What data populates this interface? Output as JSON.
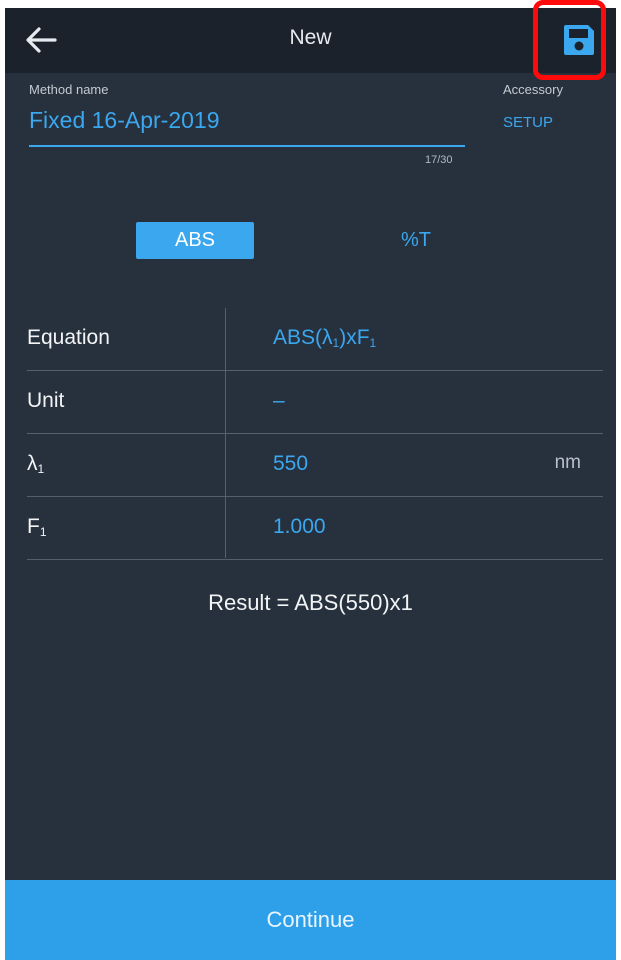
{
  "header": {
    "title": "New",
    "back_icon": "arrow-left-icon",
    "save_icon": "floppy-disk-icon"
  },
  "method": {
    "label": "Method name",
    "value": "Fixed 16-Apr-2019",
    "char_count": "17/30"
  },
  "accessory": {
    "label": "Accessory",
    "setup": "SETUP"
  },
  "mode_toggle": {
    "options": [
      "ABS",
      "%T"
    ],
    "selected": "ABS"
  },
  "params": {
    "equation_key": "Equation",
    "equation_value_a": "ABS(λ",
    "equation_sub_a": "1",
    "equation_value_b": ")xF",
    "equation_sub_b": "1",
    "unit_key": "Unit",
    "unit_value": "–",
    "lambda_key": "λ",
    "lambda_sub": "1",
    "lambda_value": "550",
    "lambda_unit": "nm",
    "f_key": "F",
    "f_sub": "1",
    "f_value": "1.000"
  },
  "result": "Result = ABS(550)x1",
  "footer": {
    "continue": "Continue"
  },
  "colors": {
    "accent": "#3aa7ef",
    "background": "#27313d",
    "topbar": "#1b222c",
    "highlight": "#ff0a0a"
  }
}
